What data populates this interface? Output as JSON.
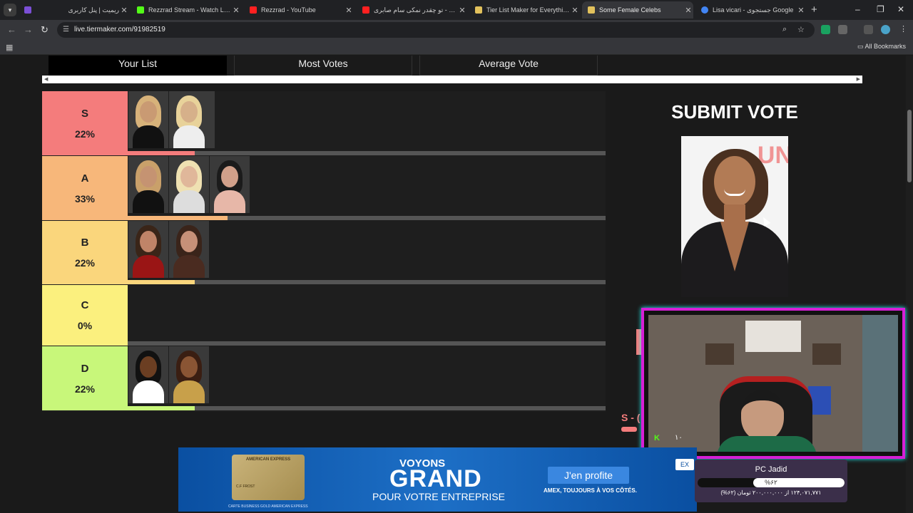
{
  "browser": {
    "tabs": [
      {
        "label": "ریمیت | پنل کاربری",
        "color": "#7b4fd6"
      },
      {
        "label": "Rezzrad Stream - Watch Live on",
        "color": "#53fc18"
      },
      {
        "label": "Rezzrad - YouTube",
        "color": "#ff2020"
      },
      {
        "label": "تو چقدر نمکی سام صابری - Tube",
        "color": "#ff2020"
      },
      {
        "label": "Tier List Maker for Everything -",
        "color": "#e2c15c"
      },
      {
        "label": "Some Female Celebs",
        "color": "#e2c15c"
      },
      {
        "label": "Lisa vicari - جستجوی Google",
        "color": "#4285f4"
      }
    ],
    "url": "live.tiermaker.com/91982519",
    "bookmarks_label": "All Bookmarks"
  },
  "view_tabs": [
    "Your List",
    "Most Votes",
    "Average Vote"
  ],
  "tiers": [
    {
      "letter": "S",
      "percent": "22%",
      "share": 0.22,
      "color": "#f47c7c",
      "items": 2
    },
    {
      "letter": "A",
      "percent": "33%",
      "share": 0.33,
      "color": "#f7b77a",
      "items": 3
    },
    {
      "letter": "B",
      "percent": "22%",
      "share": 0.22,
      "color": "#fad67c",
      "items": 2
    },
    {
      "letter": "C",
      "percent": "0%",
      "share": 0.0,
      "color": "#fbf07e",
      "items": 0
    },
    {
      "letter": "D",
      "percent": "22%",
      "share": 0.22,
      "color": "#c8f77a",
      "items": 2
    }
  ],
  "submit": {
    "title": "SUBMIT VOTE"
  },
  "peek_letter": "S - (",
  "stream": {
    "platform_icon": "K",
    "viewer_count": "۱۰"
  },
  "ad": {
    "card_brand": "AMERICAN EXPRESS",
    "card_name": "C.F FROST",
    "card_footer": "CARTE BUSINESS GOLD AMERICAN EXPRESS",
    "line1": "VOYONS",
    "line2": "GRAND",
    "line3": "POUR VOTRE ENTREPRISE",
    "button": "J'en profite",
    "tagline": "AMEX, TOUJOURS À VOS CÔTÉS.",
    "close": "EX"
  },
  "donation": {
    "title": "PC Jadid",
    "percent_label": "%۶۲",
    "progress": 0.62,
    "subtitle": "۱۲۴,۰۷۱,۷۷۱ از ۲۰۰,۰۰۰,۰۰۰ تومان (۶۲%)"
  }
}
